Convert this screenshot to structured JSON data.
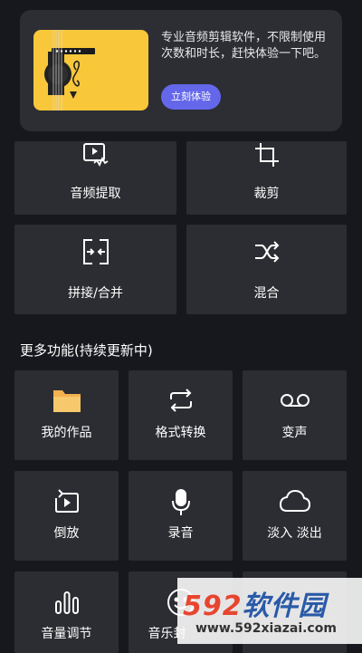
{
  "banner": {
    "text": "专业音频剪辑软件，不限制使用次数和时长，赶快体验一下吧。",
    "button_label": "立刻体验",
    "accent_color": "#6467ea",
    "art_color": "#f9c73a"
  },
  "top_tools": [
    {
      "label": "音频提取",
      "icon": "video-audio-extract-icon"
    },
    {
      "label": "裁剪",
      "icon": "crop-icon"
    },
    {
      "label": "拼接/合并",
      "icon": "merge-icon"
    },
    {
      "label": "混合",
      "icon": "shuffle-mix-icon"
    }
  ],
  "more_section": {
    "title": "更多功能(持续更新中)",
    "items": [
      {
        "label": "我的作品",
        "icon": "folder-icon"
      },
      {
        "label": "格式转换",
        "icon": "repeat-convert-icon"
      },
      {
        "label": "变声",
        "icon": "voicemail-icon"
      },
      {
        "label": "倒放",
        "icon": "reverse-play-icon"
      },
      {
        "label": "录音",
        "icon": "microphone-icon"
      },
      {
        "label": "淡入 淡出",
        "icon": "cloud-icon"
      },
      {
        "label": "音量调节",
        "icon": "volume-bars-icon"
      },
      {
        "label": "音乐封",
        "icon": "music-cover-icon"
      }
    ]
  },
  "watermark": {
    "brand_digits": "592",
    "brand_name": "软件园",
    "url": "www.592xiazai.com"
  }
}
